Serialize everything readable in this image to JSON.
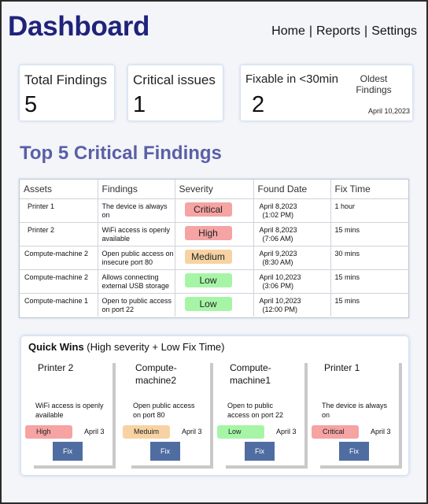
{
  "header": {
    "title": "Dashboard",
    "nav": [
      "Home",
      "Reports",
      "Settings"
    ],
    "separator": "|"
  },
  "summary": {
    "total": {
      "label": "Total Findings",
      "value": "5"
    },
    "critical": {
      "label": "Critical issues",
      "value": "1"
    },
    "fixable": {
      "label": "Fixable in <30min",
      "value": "2"
    },
    "oldest": {
      "label": "Oldest Findings",
      "date": "April 10,2023"
    }
  },
  "section_title": "Top 5 Critical Findings",
  "table": {
    "columns": [
      "Assets",
      "Findings",
      "Severity",
      "Found Date",
      "Fix Time"
    ],
    "rows": [
      {
        "asset": "Printer 1",
        "finding": "The device is always on",
        "severity": "Critical",
        "date": "April 8,2023",
        "time": "(1:02 PM)",
        "fix": "1 hour"
      },
      {
        "asset": "Printer 2",
        "finding": "WiFi access is openly available",
        "severity": "High",
        "date": "April 8,2023",
        "time": "(7:06 AM)",
        "fix": "15 mins"
      },
      {
        "asset": "Compute-machine 2",
        "finding": "Open public access on insecure port 80",
        "severity": "Medium",
        "date": "April 9,2023",
        "time": "(8:30 AM)",
        "fix": "30 mins"
      },
      {
        "asset": "Compute-machine 2",
        "finding": "Allows connecting external USB storage",
        "severity": "Low",
        "date": "April 10,2023",
        "time": "(3:06 PM)",
        "fix": "15 mins"
      },
      {
        "asset": "Compute-machine 1",
        "finding": "Open to public access on port 22",
        "severity": "Low",
        "date": "April 10,2023",
        "time": "(12:00 PM)",
        "fix": "15 mins"
      }
    ]
  },
  "severity_colors": {
    "Critical": "#f5a3a3",
    "High": "#f5a3a3",
    "Medium": "#f7d3a3",
    "Low": "#a6f5a6"
  },
  "quick_wins": {
    "title_bold": "Quick Wins",
    "title_rest": " (High severity + Low Fix Time)",
    "cards": [
      {
        "name_line1": "Printer 2",
        "name_line2": "",
        "desc": "WiFi access is openly available",
        "severity": "High",
        "date": "April 3",
        "fix_label": "Fix"
      },
      {
        "name_line1": "Compute-",
        "name_line2": "machine2",
        "desc": "Open public access on  port 80",
        "severity": "Meduim",
        "severity_key": "Medium",
        "date": "April 3",
        "fix_label": "Fix"
      },
      {
        "name_line1": "Compute-",
        "name_line2": "machine1",
        "desc": "Open to public access on port 22",
        "severity": "Low",
        "date": "April 3",
        "fix_label": "Fix"
      },
      {
        "name_line1": "Printer 1",
        "name_line2": "",
        "desc": "The device is always on",
        "severity": "Critical",
        "date": "April 3",
        "fix_label": "Fix"
      }
    ]
  }
}
